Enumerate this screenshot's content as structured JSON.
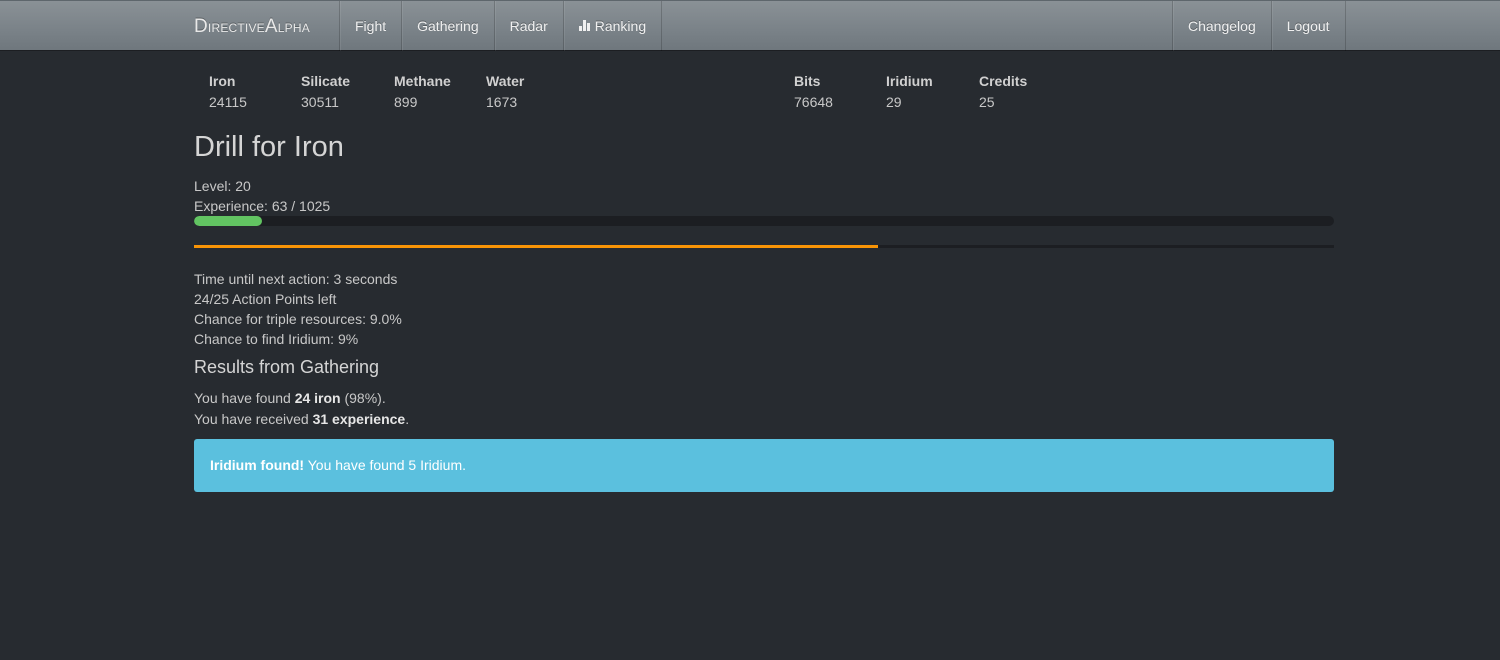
{
  "navbar": {
    "brand": {
      "first_cap": "D",
      "first_rest": "irective",
      "second_cap": "A",
      "second_rest": "lpha"
    },
    "left_items": [
      "Fight",
      "Gathering",
      "Radar",
      "Ranking"
    ],
    "right_items": [
      "Changelog",
      "Logout"
    ]
  },
  "resources": [
    {
      "label": "Iron",
      "value": "24115"
    },
    {
      "label": "Silicate",
      "value": "30511"
    },
    {
      "label": "Methane",
      "value": "899"
    },
    {
      "label": "Water",
      "value": "1673"
    },
    {
      "label": "Bits",
      "value": "76648"
    },
    {
      "label": "Iridium",
      "value": "29"
    },
    {
      "label": "Credits",
      "value": "25"
    }
  ],
  "main": {
    "title": "Drill for Iron",
    "level_text": "Level: 20",
    "experience_text": "Experience: 63 / 1025",
    "experience_fraction": 0.06,
    "action_progress_fraction": 0.6,
    "stats": [
      "Time until next action: 3 seconds",
      "24/25 Action Points left",
      "Chance for triple resources: 9.0%",
      "Chance to find Iridium: 9%"
    ],
    "results_title": "Results from Gathering",
    "result_found": {
      "prefix": "You have found ",
      "bold": "24 iron",
      "suffix": " (98%)."
    },
    "result_received": {
      "prefix": "You have received ",
      "bold": "31 experience",
      "suffix": "."
    }
  },
  "alert": {
    "bold": "Iridium found!",
    "text": " You have found 5 Iridium."
  },
  "colors": {
    "background": "#272b30",
    "xp_bar": "#62c462",
    "action_bar": "#f89406",
    "alert_info": "#5bc0de"
  },
  "icons": {
    "ranking": "bar-chart-icon"
  }
}
